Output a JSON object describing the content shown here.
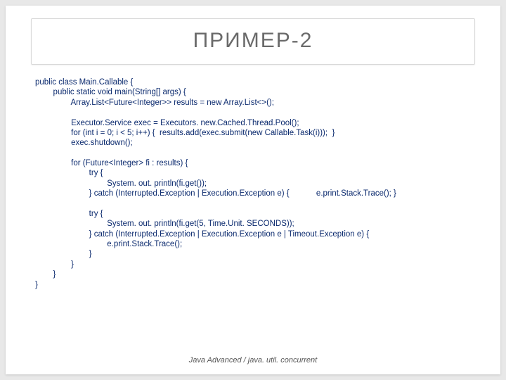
{
  "title": "ПРИМЕР-2",
  "code": "public class Main.Callable {\n        public static void main(String[] args) {\n                Array.List<Future<Integer>> results = new Array.List<>();\n\n                Executor.Service exec = Executors. new.Cached.Thread.Pool();\n                for (int i = 0; i < 5; i++) {  results.add(exec.submit(new Callable.Task(i)));  }\n                exec.shutdown();\n\n                for (Future<Integer> fi : results) {\n                        try {\n                                System. out. println(fi.get());\n                        } catch (Interrupted.Exception | Execution.Exception e) {            e.print.Stack.Trace(); }\n\n                        try {\n                                System. out. println(fi.get(5, Time.Unit. SECONDS));\n                        } catch (Interrupted.Exception | Execution.Exception e | Timeout.Exception e) {\n                                e.print.Stack.Trace();\n                        }\n                }\n        }\n}",
  "footer": "Java Advanced / java. util. concurrent"
}
